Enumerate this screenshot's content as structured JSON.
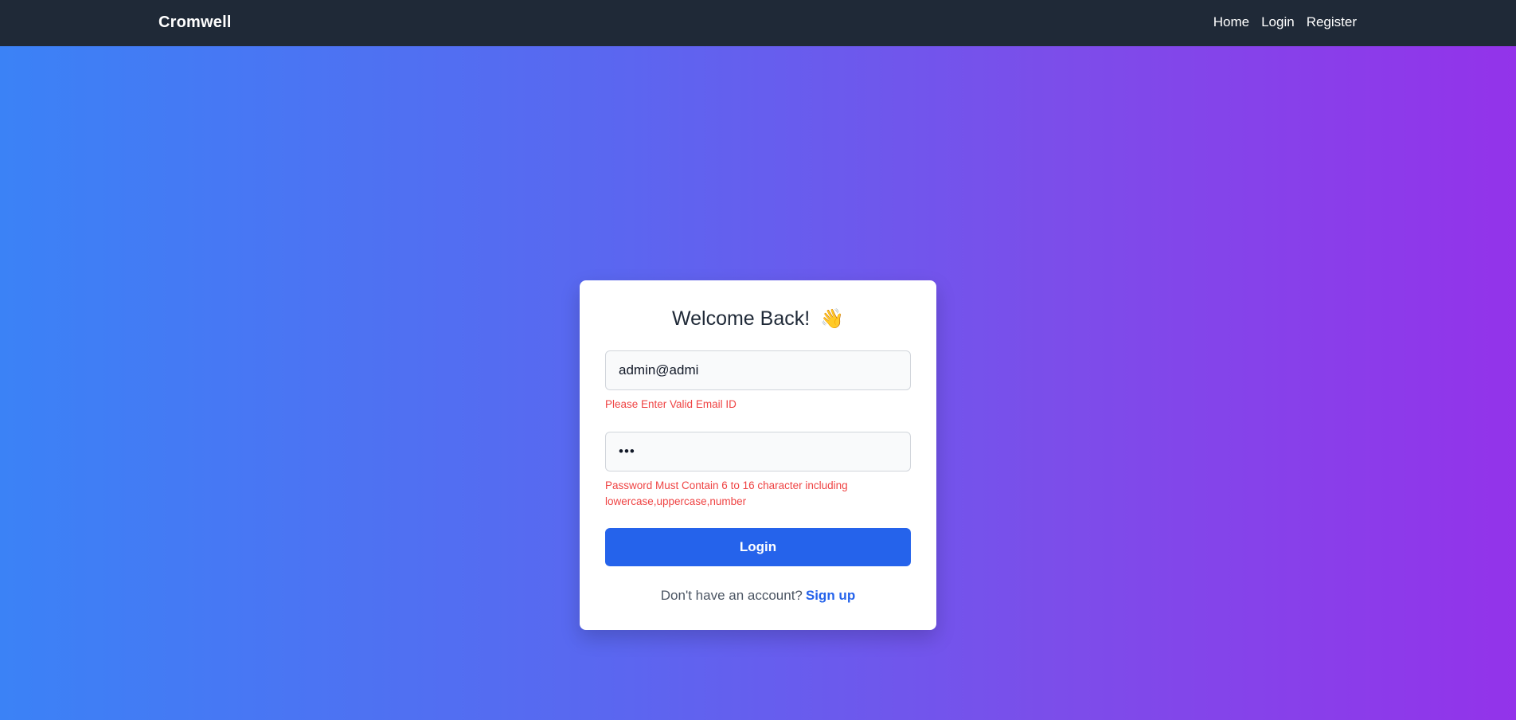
{
  "navbar": {
    "brand": "Cromwell",
    "links": [
      {
        "label": "Home"
      },
      {
        "label": "Login"
      },
      {
        "label": "Register"
      }
    ]
  },
  "login_card": {
    "title": "Welcome Back!",
    "title_emoji": "👋",
    "email": {
      "value": "admin@admi",
      "error": "Please Enter Valid Email ID"
    },
    "password": {
      "value": "•••",
      "error_line1": "Password Must Contain 6 to 16 character including",
      "error_line2": "lowercase,uppercase,number"
    },
    "login_button": "Login",
    "signup_prompt": "Don't have an account?",
    "signup_link": "Sign up"
  },
  "colors": {
    "navbar_bg": "#1f2937",
    "gradient_start": "#3b82f6",
    "gradient_end": "#9333ea",
    "primary": "#2563eb",
    "error": "#ef4444"
  },
  "icons": {
    "waving_hand": "waving-hand-icon"
  }
}
